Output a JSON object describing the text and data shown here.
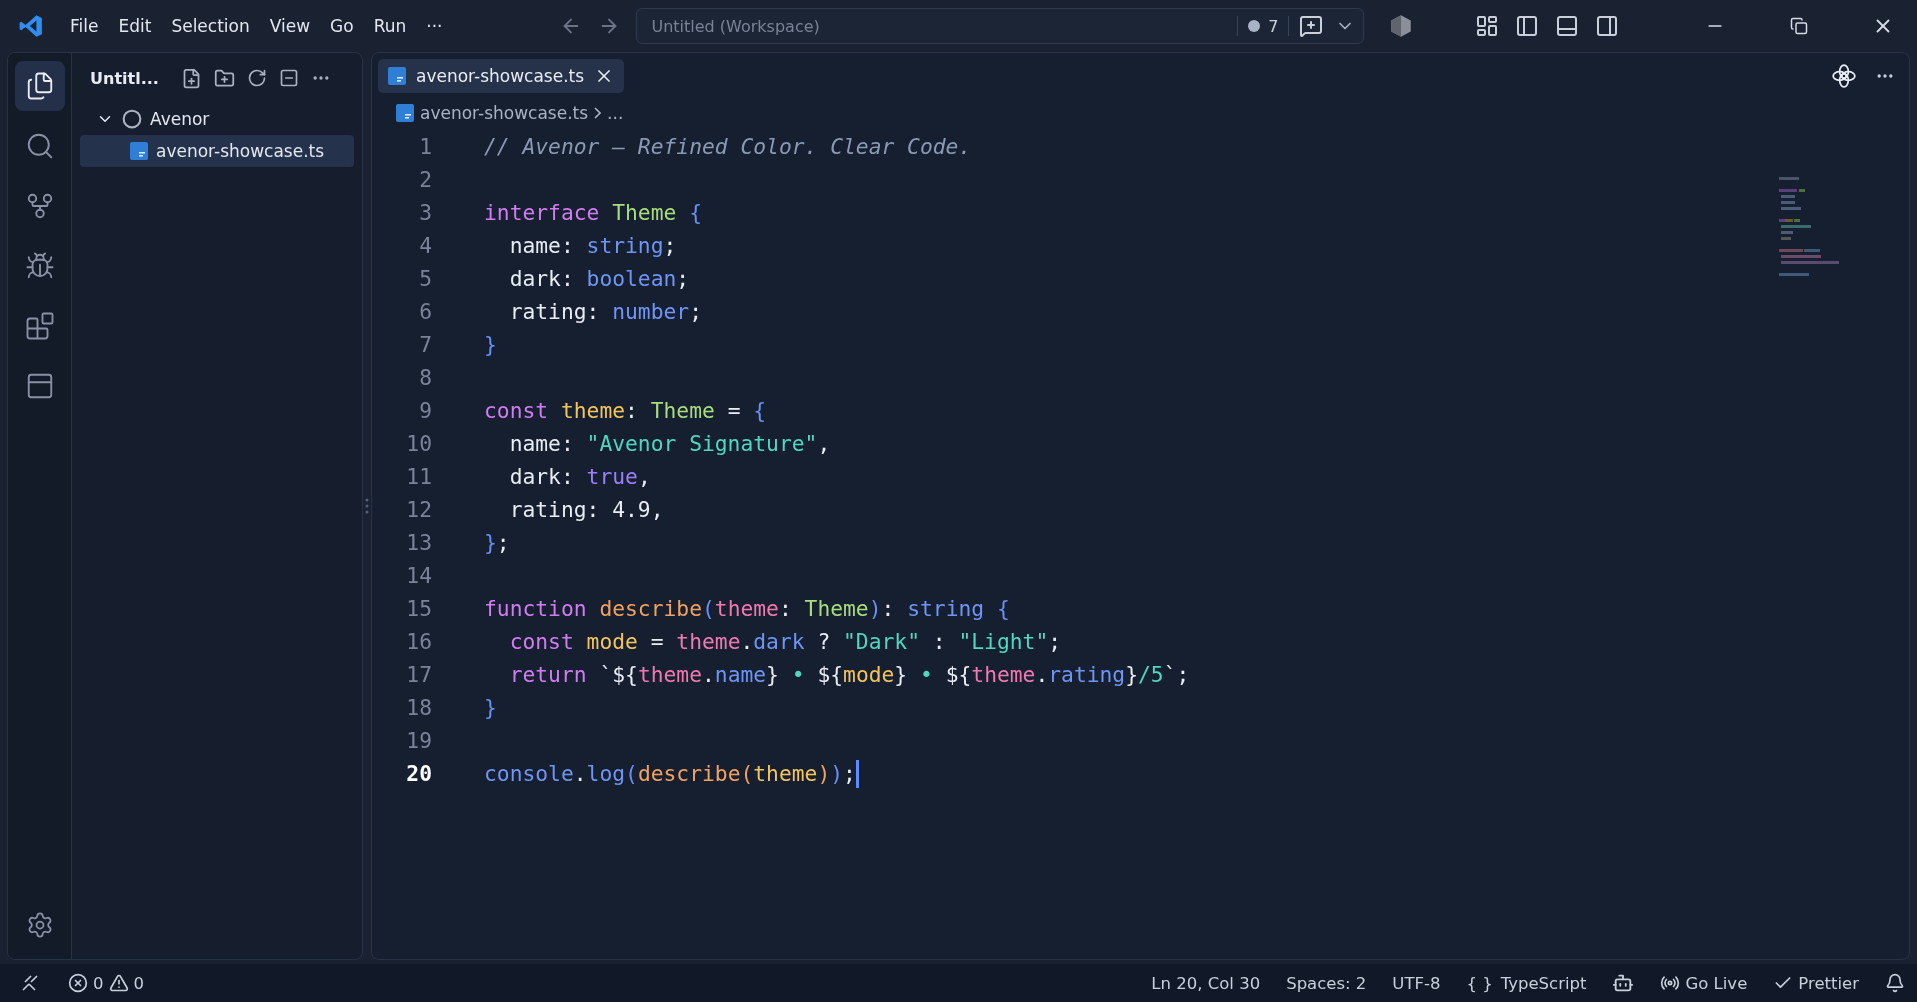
{
  "menu": [
    "File",
    "Edit",
    "Selection",
    "View",
    "Go",
    "Run",
    "···"
  ],
  "command_center": {
    "title": "Untitled (Workspace)",
    "badge": "7"
  },
  "activity_bar": [
    {
      "kind": "explorer",
      "selected": true
    },
    {
      "kind": "search",
      "selected": false
    },
    {
      "kind": "source-control",
      "selected": false
    },
    {
      "kind": "run-debug",
      "selected": false
    },
    {
      "kind": "extensions",
      "selected": false
    },
    {
      "kind": "panel",
      "selected": false
    }
  ],
  "sidebar": {
    "title": "Untitl...",
    "tree": [
      {
        "label": "Avenor",
        "kind": "folder",
        "expanded": true,
        "selected": false,
        "children": [
          {
            "label": "avenor-showcase.ts",
            "kind": "ts",
            "selected": true
          }
        ]
      }
    ]
  },
  "tabs": [
    {
      "label": "avenor-showcase.ts",
      "selected": true
    }
  ],
  "breadcrumb": {
    "file": "avenor-showcase.ts",
    "rest": "..."
  },
  "lines": [
    {
      "number": "1",
      "current": false,
      "tokens": [
        {
          "text": "// Avenor — Refined Color. Clear Code.",
          "kind": "comment"
        }
      ]
    },
    {
      "number": "2",
      "current": false
    },
    {
      "number": "3",
      "current": false,
      "tokens": [
        {
          "text": "interface ",
          "kind": "keyword"
        },
        {
          "text": "Theme",
          "kind": "type"
        },
        {
          "text": " {",
          "kind": "brace"
        }
      ]
    },
    {
      "number": "4",
      "current": false,
      "tokens": [
        {
          "text": "  name: ",
          "kind": "plain"
        },
        {
          "text": "string",
          "kind": "prim"
        },
        {
          "text": ";",
          "kind": "plain"
        }
      ]
    },
    {
      "number": "5",
      "current": false,
      "tokens": [
        {
          "text": "  dark: ",
          "kind": "plain"
        },
        {
          "text": "boolean",
          "kind": "prim"
        },
        {
          "text": ";",
          "kind": "plain"
        }
      ]
    },
    {
      "number": "6",
      "current": false,
      "tokens": [
        {
          "text": "  rating: ",
          "kind": "plain"
        },
        {
          "text": "number",
          "kind": "prim"
        },
        {
          "text": ";",
          "kind": "plain"
        }
      ]
    },
    {
      "number": "7",
      "current": false,
      "tokens": [
        {
          "text": "}",
          "kind": "brace"
        }
      ]
    },
    {
      "number": "8",
      "current": false
    },
    {
      "number": "9",
      "current": false,
      "tokens": [
        {
          "text": "const ",
          "kind": "keyword"
        },
        {
          "text": "theme",
          "kind": "variable"
        },
        {
          "text": ": ",
          "kind": "plain"
        },
        {
          "text": "Theme",
          "kind": "type"
        },
        {
          "text": " = ",
          "kind": "plain"
        },
        {
          "text": "{",
          "kind": "brace"
        }
      ]
    },
    {
      "number": "10",
      "current": false,
      "tokens": [
        {
          "text": "  name: ",
          "kind": "plain"
        },
        {
          "text": "\"Avenor Signature\"",
          "kind": "string"
        },
        {
          "text": ",",
          "kind": "plain"
        }
      ]
    },
    {
      "number": "11",
      "current": false,
      "tokens": [
        {
          "text": "  dark: ",
          "kind": "plain"
        },
        {
          "text": "true",
          "kind": "literal"
        },
        {
          "text": ",",
          "kind": "plain"
        }
      ]
    },
    {
      "number": "12",
      "current": false,
      "tokens": [
        {
          "text": "  rating: 4.9,",
          "kind": "plain"
        }
      ]
    },
    {
      "number": "13",
      "current": false,
      "tokens": [
        {
          "text": "}",
          "kind": "brace"
        },
        {
          "text": ";",
          "kind": "plain"
        }
      ]
    },
    {
      "number": "14",
      "current": false
    },
    {
      "number": "15",
      "current": false,
      "tokens": [
        {
          "text": "function ",
          "kind": "keyword"
        },
        {
          "text": "describe",
          "kind": "func"
        },
        {
          "text": "(",
          "kind": "brace"
        },
        {
          "text": "theme",
          "kind": "param"
        },
        {
          "text": ": ",
          "kind": "plain"
        },
        {
          "text": "Theme",
          "kind": "type"
        },
        {
          "text": ")",
          "kind": "brace"
        },
        {
          "text": ": ",
          "kind": "plain"
        },
        {
          "text": "string",
          "kind": "prim"
        },
        {
          "text": " {",
          "kind": "brace"
        }
      ]
    },
    {
      "number": "16",
      "current": false,
      "tokens": [
        {
          "text": "  const ",
          "kind": "keyword"
        },
        {
          "text": "mode",
          "kind": "variable"
        },
        {
          "text": " = ",
          "kind": "plain"
        },
        {
          "text": "theme",
          "kind": "param"
        },
        {
          "text": ".",
          "kind": "plain"
        },
        {
          "text": "dark",
          "kind": "prim"
        },
        {
          "text": " ? ",
          "kind": "plain"
        },
        {
          "text": "\"Dark\"",
          "kind": "string"
        },
        {
          "text": " : ",
          "kind": "plain"
        },
        {
          "text": "\"Light\"",
          "kind": "string"
        },
        {
          "text": ";",
          "kind": "plain"
        }
      ]
    },
    {
      "number": "17",
      "current": false,
      "tokens": [
        {
          "text": "  return",
          "kind": "keyword"
        },
        {
          "text": " `${",
          "kind": "plain"
        },
        {
          "text": "theme",
          "kind": "param"
        },
        {
          "text": ".",
          "kind": "plain"
        },
        {
          "text": "name",
          "kind": "prim"
        },
        {
          "text": "}",
          "kind": "plain"
        },
        {
          "text": " • ",
          "kind": "string"
        },
        {
          "text": "${",
          "kind": "plain"
        },
        {
          "text": "mode",
          "kind": "variable"
        },
        {
          "text": "}",
          "kind": "plain"
        },
        {
          "text": " • ",
          "kind": "string"
        },
        {
          "text": "${",
          "kind": "plain"
        },
        {
          "text": "theme",
          "kind": "param"
        },
        {
          "text": ".",
          "kind": "plain"
        },
        {
          "text": "rating",
          "kind": "prim"
        },
        {
          "text": "}",
          "kind": "plain"
        },
        {
          "text": "/5",
          "kind": "string"
        },
        {
          "text": "`;",
          "kind": "plain"
        }
      ]
    },
    {
      "number": "18",
      "current": false,
      "tokens": [
        {
          "text": "}",
          "kind": "brace"
        }
      ]
    },
    {
      "number": "19",
      "current": false
    },
    {
      "number": "20",
      "current": true,
      "tokens": [
        {
          "text": "console",
          "kind": "prim"
        },
        {
          "text": ".",
          "kind": "plain"
        },
        {
          "text": "log",
          "kind": "prim"
        },
        {
          "text": "(",
          "kind": "brace"
        },
        {
          "text": "describe",
          "kind": "func"
        },
        {
          "text": "(",
          "kind": "func"
        },
        {
          "text": "theme",
          "kind": "variable"
        },
        {
          "text": ")",
          "kind": "func"
        },
        {
          "text": ")",
          "kind": "brace"
        },
        {
          "text": ";",
          "kind": "plain"
        }
      ]
    }
  ],
  "status_bar": {
    "errors": "0",
    "warnings": "0",
    "position": "Ln 20, Col 30",
    "spaces": "Spaces: 2",
    "encoding": "UTF-8",
    "language_braces": "{ }",
    "language": "TypeScript",
    "go_live": "Go Live",
    "prettier": "Prettier"
  }
}
